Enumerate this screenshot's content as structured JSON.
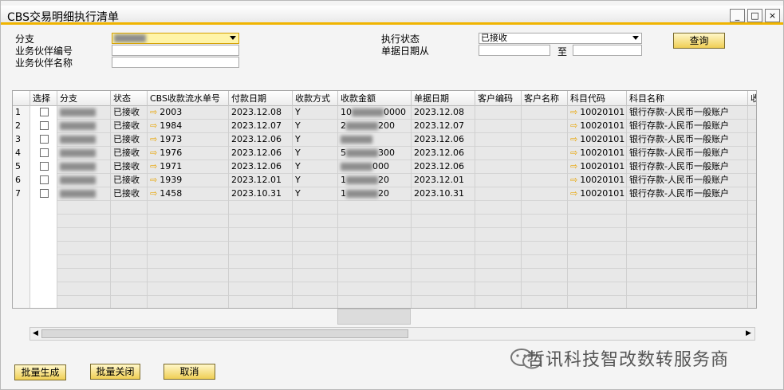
{
  "window": {
    "title": "CBS交易明细执行清单",
    "minimize": "_",
    "maximize": "□",
    "close": "×"
  },
  "filters": {
    "branch_label": "分支",
    "branch_value": "",
    "partner_code_label": "业务伙伴编号",
    "partner_code_value": "",
    "partner_name_label": "业务伙伴名称",
    "partner_name_value": "",
    "status_label": "执行状态",
    "status_value": "已接收",
    "date_from_label": "单据日期从",
    "date_from_value": "",
    "date_to_label": "至",
    "date_to_value": "",
    "query_button": "查询"
  },
  "grid": {
    "columns": [
      "选择",
      "分支",
      "状态",
      "CBS收款流水单号",
      "付款日期",
      "收款方式",
      "收款金额",
      "单据日期",
      "客户编码",
      "客户名称",
      "科目代码",
      "科目名称",
      "收"
    ],
    "rows": [
      {
        "num": "1",
        "status": "已接收",
        "serial": "2003",
        "pay_date": "2023.12.08",
        "method": "Y",
        "amount_head": "10",
        "amount_tail": "0000",
        "doc_date": "2023.12.08",
        "acct_code": "10020101",
        "acct_name": "银行存款-人民币一般账户"
      },
      {
        "num": "2",
        "status": "已接收",
        "serial": "1984",
        "pay_date": "2023.12.07",
        "method": "Y",
        "amount_head": "2",
        "amount_tail": "200",
        "doc_date": "2023.12.07",
        "acct_code": "10020101",
        "acct_name": "银行存款-人民币一般账户"
      },
      {
        "num": "3",
        "status": "已接收",
        "serial": "1973",
        "pay_date": "2023.12.06",
        "method": "Y",
        "amount_head": "",
        "amount_tail": "",
        "doc_date": "2023.12.06",
        "acct_code": "10020101",
        "acct_name": "银行存款-人民币一般账户"
      },
      {
        "num": "4",
        "status": "已接收",
        "serial": "1976",
        "pay_date": "2023.12.06",
        "method": "Y",
        "amount_head": "5",
        "amount_tail": "300",
        "doc_date": "2023.12.06",
        "acct_code": "10020101",
        "acct_name": "银行存款-人民币一般账户"
      },
      {
        "num": "5",
        "status": "已接收",
        "serial": "1971",
        "pay_date": "2023.12.06",
        "method": "Y",
        "amount_head": "",
        "amount_tail": "000",
        "doc_date": "2023.12.06",
        "acct_code": "10020101",
        "acct_name": "银行存款-人民币一般账户"
      },
      {
        "num": "6",
        "status": "已接收",
        "serial": "1939",
        "pay_date": "2023.12.01",
        "method": "Y",
        "amount_head": "1",
        "amount_tail": "20",
        "doc_date": "2023.12.01",
        "acct_code": "10020101",
        "acct_name": "银行存款-人民币一般账户"
      },
      {
        "num": "7",
        "status": "已接收",
        "serial": "1458",
        "pay_date": "2023.10.31",
        "method": "Y",
        "amount_head": "1",
        "amount_tail": "20",
        "doc_date": "2023.10.31",
        "acct_code": "10020101",
        "acct_name": "银行存款-人民币一般账户"
      }
    ]
  },
  "footer": {
    "batch_generate": "批量生成",
    "batch_close": "批量关闭",
    "cancel": "取消"
  },
  "watermark": {
    "text": "哲讯科技智改数转服务商"
  },
  "colors": {
    "accent": "#f0b400",
    "field_highlight": "#fff4a8",
    "arrow": "#e8a400"
  }
}
